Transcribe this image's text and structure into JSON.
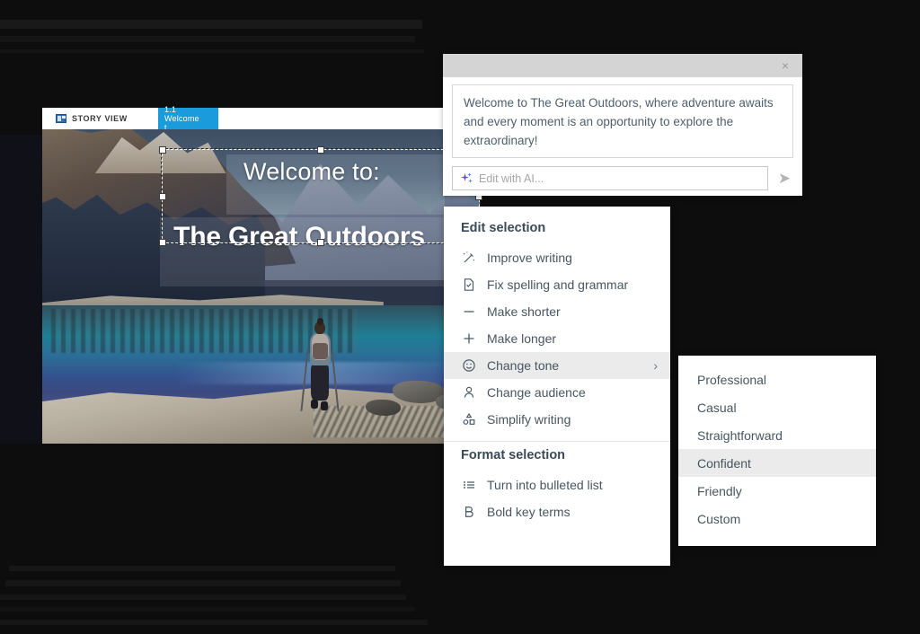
{
  "app": {
    "tabs": [
      {
        "label": "STORY VIEW",
        "icon": "story-view-icon",
        "active": false
      },
      {
        "label": "1.1 Welcome t...",
        "active": true
      }
    ]
  },
  "slide": {
    "title_line1": "Welcome to:",
    "title_line2": "The Great Outdoors",
    "scene": "mountain-lake-hiker"
  },
  "ai_panel": {
    "close_label": "×",
    "generated_text": "Welcome to The Great Outdoors, where adventure awaits and every moment is an opportunity to explore the extraordinary!",
    "input": {
      "value": "",
      "placeholder": "Edit with AI...",
      "icon": "ai-sparkle-icon"
    },
    "send_label": "➤"
  },
  "context_menu": {
    "edit_section_title": "Edit selection",
    "edit_items": [
      {
        "label": "Improve writing",
        "icon": "magic-wand-icon",
        "has_submenu": false,
        "active": false
      },
      {
        "label": "Fix spelling and grammar",
        "icon": "document-check-icon",
        "has_submenu": false,
        "active": false
      },
      {
        "label": "Make shorter",
        "icon": "minus-icon",
        "has_submenu": false,
        "active": false
      },
      {
        "label": "Make longer",
        "icon": "plus-icon",
        "has_submenu": false,
        "active": false
      },
      {
        "label": "Change tone",
        "icon": "smiley-icon",
        "has_submenu": true,
        "active": true
      },
      {
        "label": "Change audience",
        "icon": "person-icon",
        "has_submenu": false,
        "active": false
      },
      {
        "label": "Simplify writing",
        "icon": "shapes-icon",
        "has_submenu": false,
        "active": false
      }
    ],
    "format_section_title": "Format selection",
    "format_items": [
      {
        "label": "Turn into bulleted list",
        "icon": "bulleted-list-icon"
      },
      {
        "label": "Bold key terms",
        "icon": "bold-icon"
      }
    ],
    "submenu_arrow": "›"
  },
  "tone_menu": {
    "items": [
      {
        "label": "Professional",
        "active": false
      },
      {
        "label": "Casual",
        "active": false
      },
      {
        "label": "Straightforward",
        "active": false
      },
      {
        "label": "Confident",
        "active": true
      },
      {
        "label": "Friendly",
        "active": false
      },
      {
        "label": "Custom",
        "active": false
      }
    ]
  },
  "colors": {
    "accent_tab": "#1a9bdc",
    "menu_text": "#47565f",
    "highlight": "#ebebeb",
    "ai_sparkle": "#5b4ae0",
    "panel_header": "#d4d4d4"
  }
}
